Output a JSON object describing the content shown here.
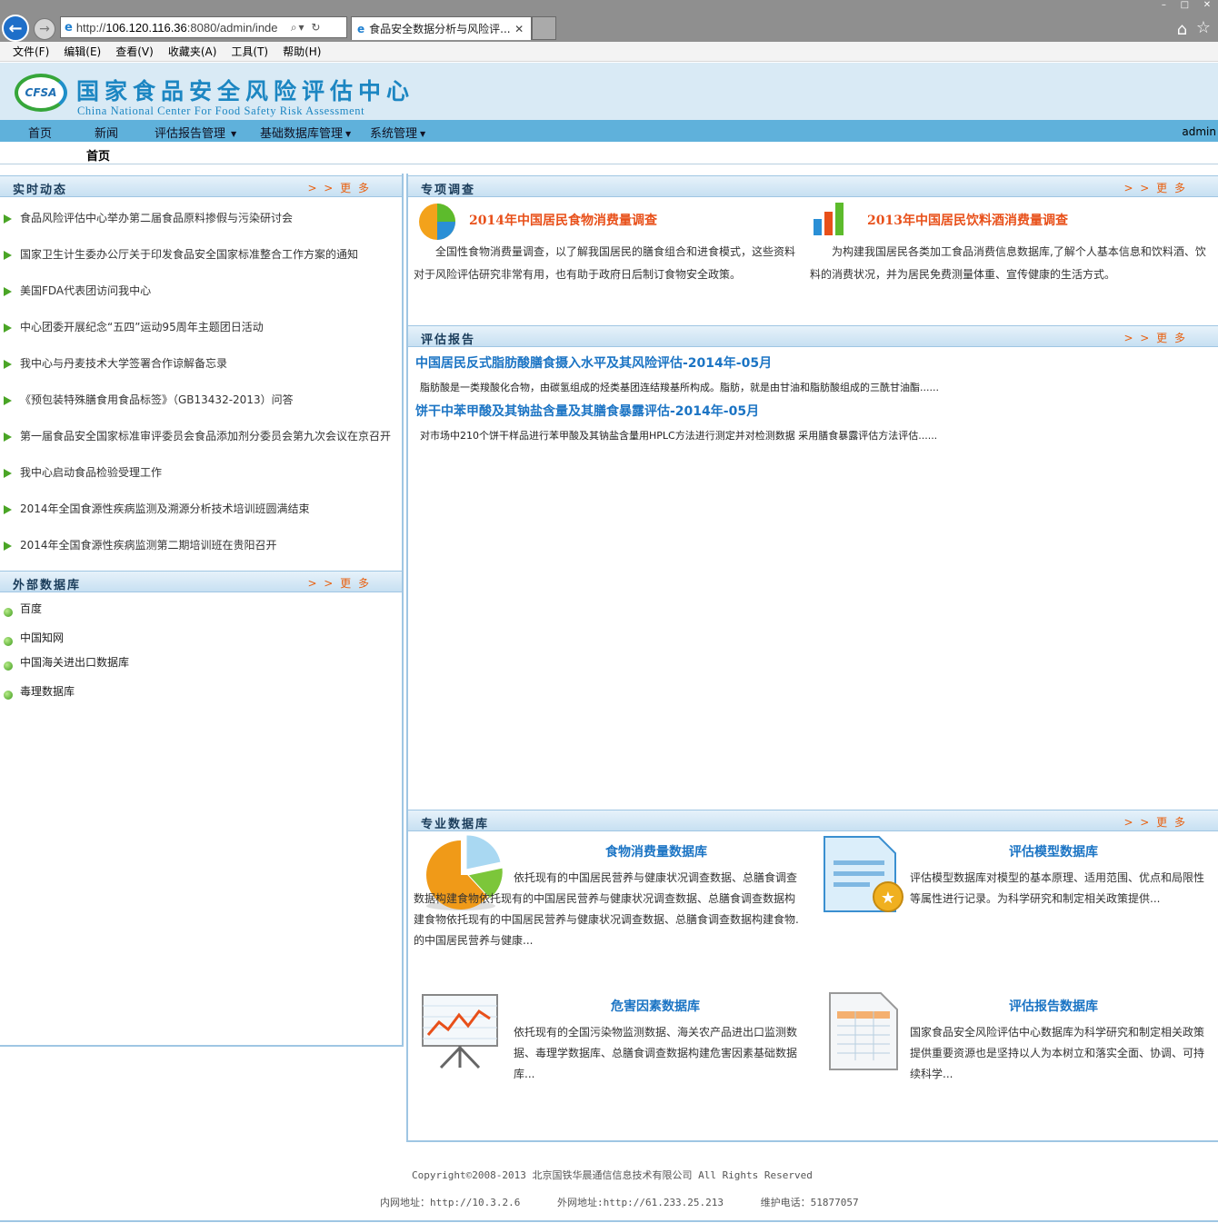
{
  "browser": {
    "url_prefix": "http://",
    "url_host": "106.120.116.36",
    "url_rest": ":8080/admin/inde",
    "tab_title": "食品安全数据分析与风险评...",
    "menu": [
      "文件(F)",
      "编辑(E)",
      "查看(V)",
      "收藏夹(A)",
      "工具(T)",
      "帮助(H)"
    ]
  },
  "header": {
    "logo_badge": "CFSA",
    "logo_cn": "国家食品安全风险评估中心",
    "logo_en": "China National Center For Food Safety Risk Assessment"
  },
  "nav": {
    "items": [
      {
        "label": "首页"
      },
      {
        "label": "新闻"
      },
      {
        "label": "评估报告管理",
        "dropdown": true
      },
      {
        "label": "基础数据库管理",
        "dropdown": true
      },
      {
        "label": "系统管理",
        "dropdown": true
      }
    ],
    "user": "admin",
    "subnav_current": "首页"
  },
  "more_label": "> > 更 多",
  "news": {
    "title": "实时动态",
    "items": [
      "食品风险评估中心举办第二届食品原料掺假与污染研讨会",
      "国家卫生计生委办公厅关于印发食品安全国家标准整合工作方案的通知",
      "美国FDA代表团访问我中心",
      "中心团委开展纪念“五四”运动95周年主题团日活动",
      "我中心与丹麦技术大学签署合作谅解备忘录",
      "《预包装特殊膳食用食品标签》（GB13432-2013）问答",
      "第一届食品安全国家标准审评委员会食品添加剂分委员会第九次会议在京召开",
      "我中心启动食品检验受理工作",
      "2014年全国食源性疾病监测及溯源分析技术培训班圆满结束",
      "2014年全国食源性疾病监测第二期培训班在贵阳召开"
    ]
  },
  "external_db": {
    "title": "外部数据库",
    "items": [
      "百度",
      "中国知网",
      "中国海关进出口数据库",
      "毒理数据库"
    ]
  },
  "survey": {
    "title": "专项调查",
    "items": [
      {
        "title": "2014年中国居民食物消费量调查",
        "icon": "pie-chart-icon",
        "desc": "全国性食物消费量调查，以了解我国居民的膳食组合和进食模式，这些资料对于风险评估研究非常有用，也有助于政府日后制订食物安全政策。"
      },
      {
        "title": "2013年中国居民饮料酒消费量调查",
        "icon": "bar-chart-icon",
        "desc": "为构建我国居民各类加工食品消费信息数据库,了解个人基本信息和饮料酒、饮料的消费状况，并为居民免费测量体重、宣传健康的生活方式。"
      }
    ]
  },
  "reports": {
    "title": "评估报告",
    "items": [
      {
        "title": "中国居民反式脂肪酸膳食摄入水平及其风险评估-2014年-05月",
        "desc": "脂肪酸是一类羧酸化合物，由碳氢组成的烃类基团连结羧基所构成。脂肪，就是由甘油和脂肪酸组成的三酰甘油酯......"
      },
      {
        "title": "饼干中苯甲酸及其钠盐含量及其膳食暴露评估-2014年-05月",
        "desc": "对市场中210个饼干样品进行苯甲酸及其钠盐含量用HPLC方法进行测定并对检测数据 采用膳食暴露评估方法评估......"
      }
    ]
  },
  "pro_db": {
    "title": "专业数据库",
    "items": [
      {
        "title": "食物消费量数据库",
        "icon": "pie-chart-icon",
        "desc": "依托现有的中国居民营养与健康状况调查数据、总膳食调查数据构建食物依托现有的中国居民营养与健康状况调查数据、总膳食调查数据构建食物依托现有的中国居民营养与健康状况调查数据、总膳食调查数据构建食物.的中国居民营养与健康..."
      },
      {
        "title": "评估模型数据库",
        "icon": "document-star-icon",
        "desc": "评估模型数据库对模型的基本原理、适用范围、优点和局限性等属性进行记录。为科学研究和制定相关政策提供..."
      },
      {
        "title": "危害因素数据库",
        "icon": "presentation-chart-icon",
        "desc": "依托现有的全国污染物监测数据、海关农产品进出口监测数据、毒理学数据库、总膳食调查数据构建危害因素基础数据库..."
      },
      {
        "title": "评估报告数据库",
        "icon": "spreadsheet-icon",
        "desc": "国家食品安全风险评估中心数据库为科学研究和制定相关政策提供重要资源也是坚持以人为本树立和落实全面、协调、可持续科学..."
      }
    ]
  },
  "footer": {
    "copyright": "Copyright©2008-2013 北京国铁华晨通信信息技术有限公司 All Rights Reserved",
    "intranet": "内网地址：http://10.3.2.6",
    "extranet": "外网地址:http://61.233.25.213",
    "phone": "维护电话：51877057"
  }
}
